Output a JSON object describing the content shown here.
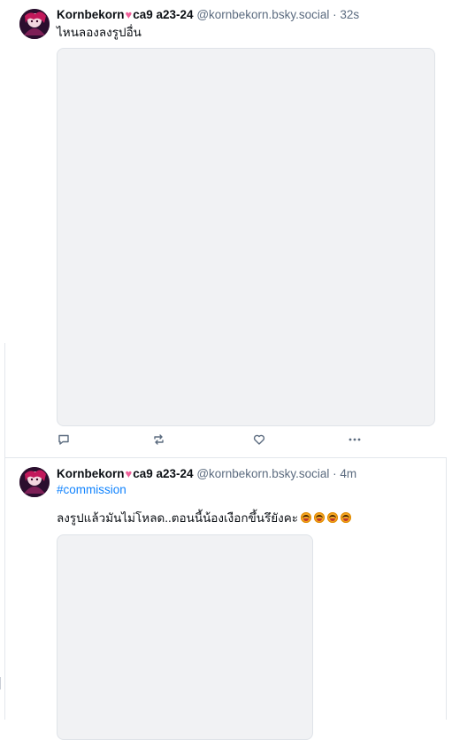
{
  "posts": [
    {
      "display_name": "Kornbekorn",
      "name_suffix": "ca9 a23-24",
      "handle": "@kornbekorn.bsky.social",
      "separator": "·",
      "time": "32s",
      "text": "ไหนลองลงรูปอื่น",
      "actions": {
        "reply_icon": "speech-bubble-icon",
        "repost_icon": "repost-icon",
        "like_icon": "heart-outline-icon",
        "more_icon": "more-dots-icon"
      }
    },
    {
      "display_name": "Kornbekorn",
      "name_suffix": "ca9 a23-24",
      "handle": "@kornbekorn.bsky.social",
      "separator": "·",
      "time": "4m",
      "hashtag": "#commission",
      "text": "ลงรูปแล้วมันไม่โหลด..ตอนนี้น้องเงือกขึ้นรึยังคะ",
      "emoji_count": 4
    }
  ],
  "colors": {
    "name_heart": "#f0609a",
    "handle": "#5b6b7f",
    "hashtag": "#1083fe",
    "media_placeholder": "#f1f2f4",
    "divider": "#e3e7ec"
  }
}
